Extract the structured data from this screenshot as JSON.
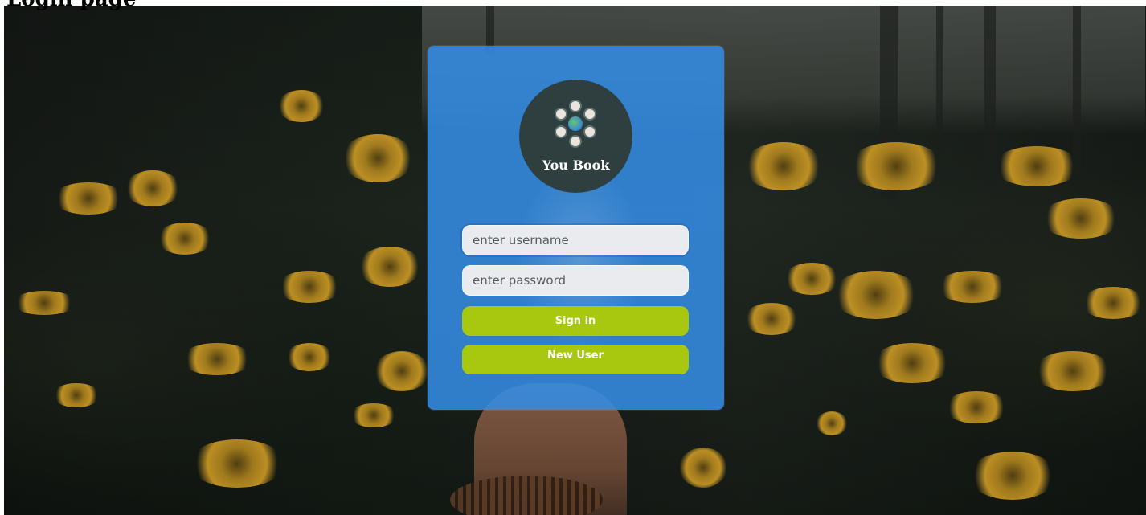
{
  "page": {
    "heading": "Login page"
  },
  "logo": {
    "text": "You Book",
    "icon": "people-globe-logo"
  },
  "form": {
    "username_placeholder": "enter username",
    "username_value": "",
    "password_placeholder": "enter password",
    "password_value": "",
    "signin_label": "Sign in",
    "newuser_label": "New User"
  },
  "colors": {
    "card": "#348ce4",
    "button": "#a8c80f",
    "input_bg": "#e9ebee",
    "logo_bg": "#2f3f3f"
  }
}
